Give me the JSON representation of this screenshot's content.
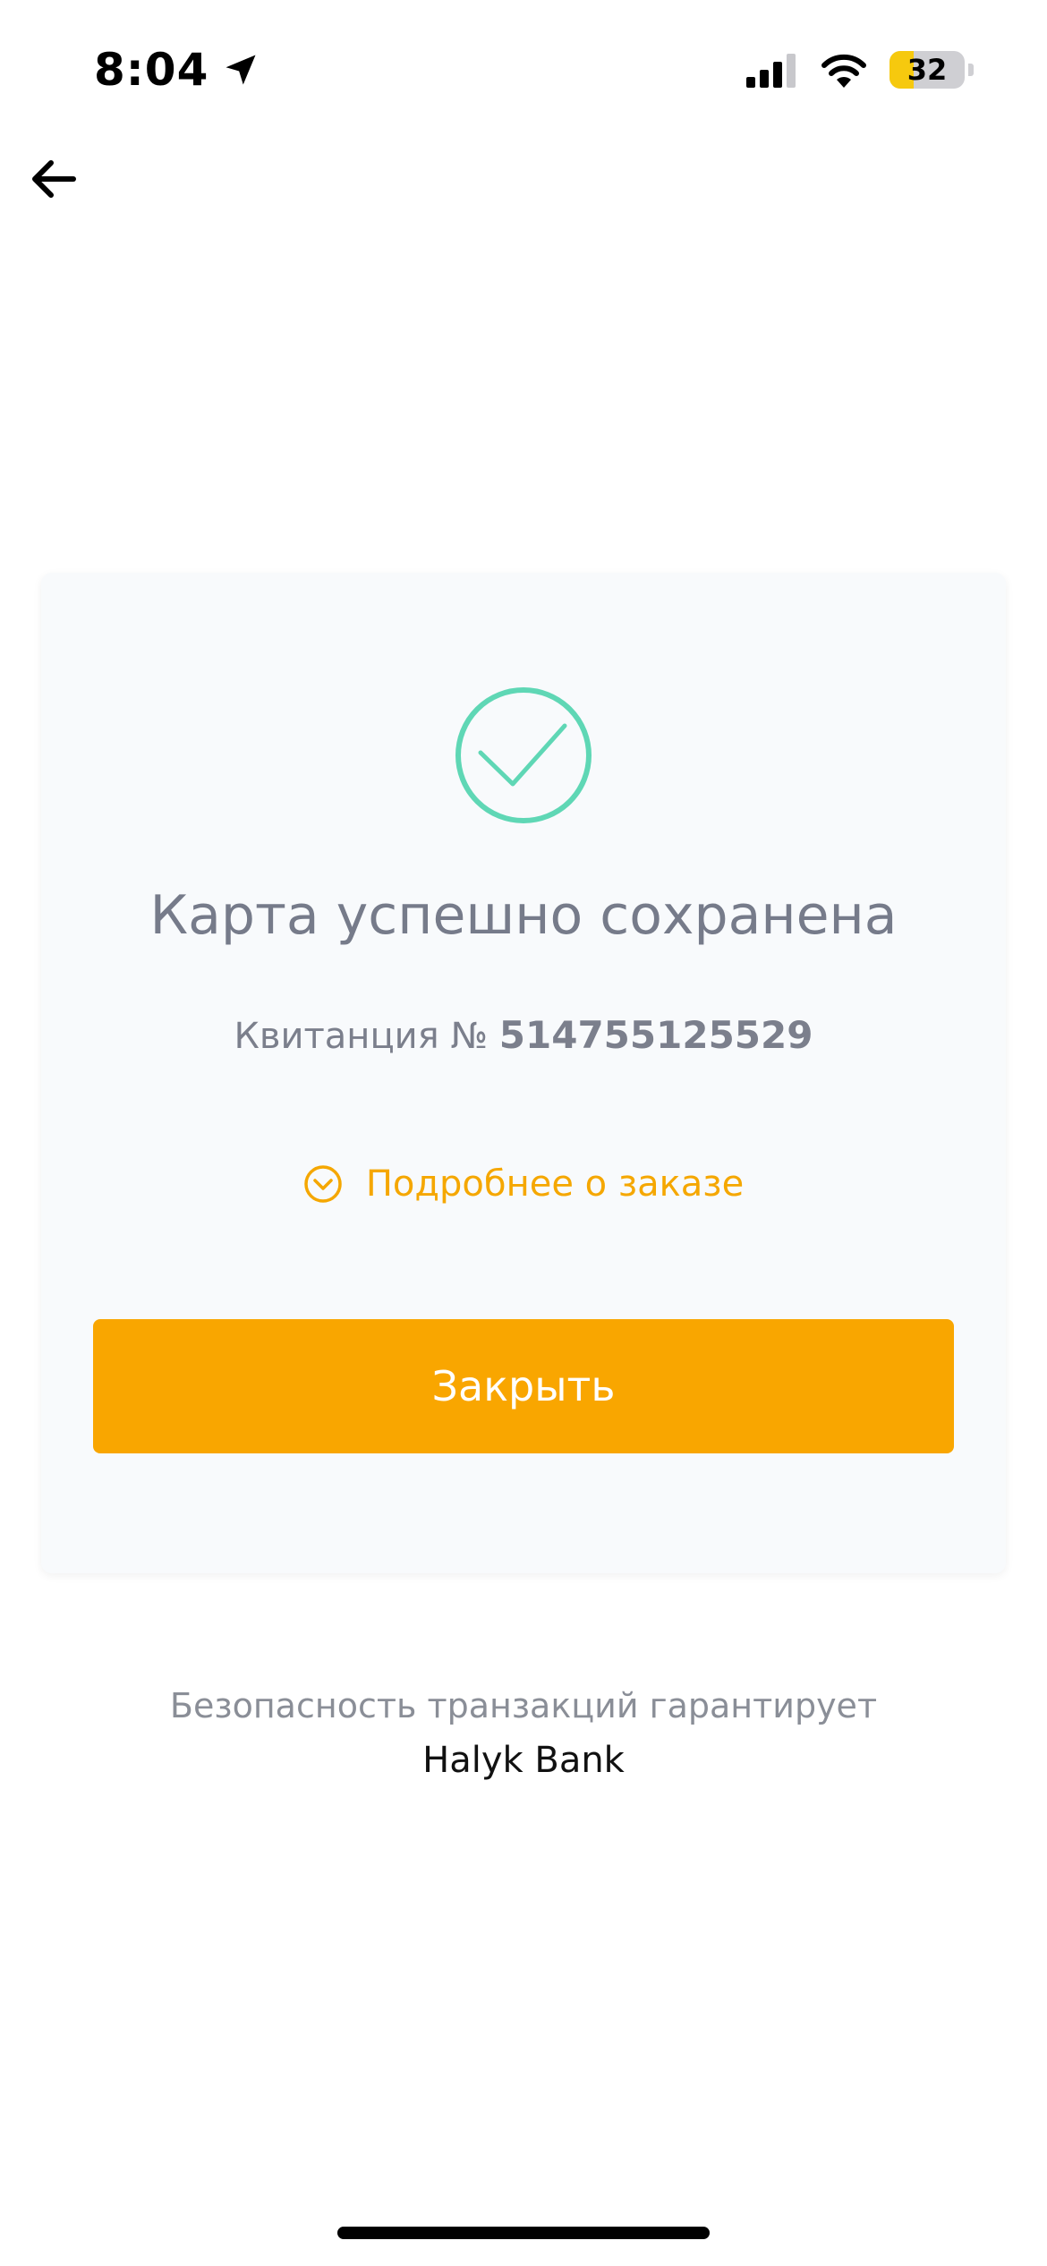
{
  "status_bar": {
    "time": "8:04",
    "battery_percent": "32",
    "battery_level": 0.32,
    "icons": [
      "location-arrow-icon",
      "cellular-signal-icon",
      "wifi-icon",
      "battery-icon"
    ]
  },
  "nav": {
    "back_icon": "arrow-left-icon"
  },
  "card": {
    "status_icon": "check-circle-icon",
    "title": "Карта успешно сохранена",
    "receipt_label": "Квитанция №",
    "receipt_number": "514755125529",
    "details_icon": "chevron-down-circle-icon",
    "details_link": "Подробнее о заказе",
    "close_button": "Закрыть"
  },
  "footer": {
    "security_text": "Безопасность транзакций гарантирует",
    "bank_name": "Halyk Bank"
  },
  "colors": {
    "accent": "#f9a600",
    "success": "#5fd7b5",
    "card_background": "#f8fafc",
    "title_text": "#767b8a"
  }
}
